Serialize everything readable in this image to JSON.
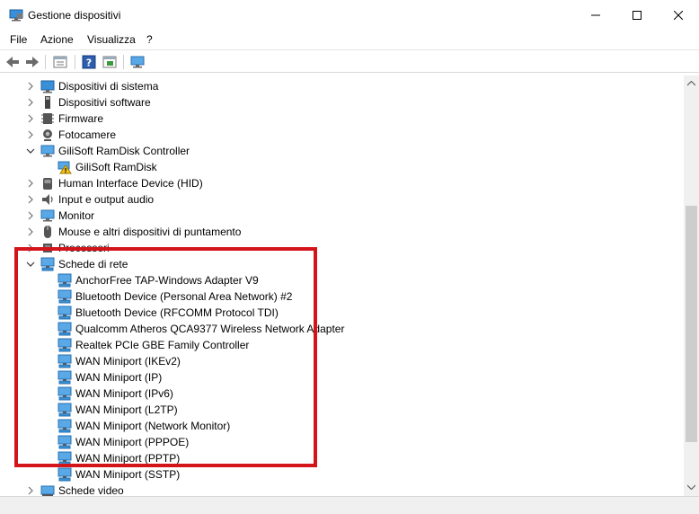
{
  "window": {
    "title": "Gestione dispositivi"
  },
  "menu": [
    "File",
    "Azione",
    "Visualizza",
    "?"
  ],
  "toolbar": {
    "buttons": [
      "back-icon",
      "forward-icon",
      "properties-icon",
      "help-icon",
      "driver-icon",
      "monitor-icon"
    ]
  },
  "tree": {
    "items": [
      {
        "label": "Dispositivi di sistema",
        "icon": "system-device-icon",
        "expanded": false,
        "level": 0
      },
      {
        "label": "Dispositivi software",
        "icon": "software-device-icon",
        "expanded": false,
        "level": 0
      },
      {
        "label": "Firmware",
        "icon": "firmware-icon",
        "expanded": false,
        "level": 0
      },
      {
        "label": "Fotocamere",
        "icon": "camera-icon",
        "expanded": false,
        "level": 0
      },
      {
        "label": "GiliSoft RamDisk Controller",
        "icon": "monitor-icon",
        "expanded": true,
        "level": 0
      },
      {
        "label": "GiliSoft RamDisk",
        "icon": "warning-device-icon",
        "level": 1
      },
      {
        "label": "Human Interface Device (HID)",
        "icon": "hid-icon",
        "expanded": false,
        "level": 0
      },
      {
        "label": "Input e output audio",
        "icon": "speaker-icon",
        "expanded": false,
        "level": 0
      },
      {
        "label": "Monitor",
        "icon": "monitor-icon",
        "expanded": false,
        "level": 0
      },
      {
        "label": "Mouse e altri dispositivi di puntamento",
        "icon": "mouse-icon",
        "expanded": false,
        "level": 0
      },
      {
        "label": "Processori",
        "icon": "processor-icon",
        "expanded": false,
        "level": 0
      },
      {
        "label": "Schede di rete",
        "icon": "network-adapter-icon",
        "expanded": true,
        "level": 0
      },
      {
        "label": "AnchorFree TAP-Windows Adapter V9",
        "icon": "network-adapter-icon",
        "level": 1
      },
      {
        "label": "Bluetooth Device (Personal Area Network) #2",
        "icon": "network-adapter-icon",
        "level": 1
      },
      {
        "label": "Bluetooth Device (RFCOMM Protocol TDI)",
        "icon": "network-adapter-icon",
        "level": 1
      },
      {
        "label": "Qualcomm Atheros QCA9377 Wireless Network Adapter",
        "icon": "network-adapter-icon",
        "level": 1
      },
      {
        "label": "Realtek PCIe GBE Family Controller",
        "icon": "network-adapter-icon",
        "level": 1
      },
      {
        "label": "WAN Miniport (IKEv2)",
        "icon": "network-adapter-icon",
        "level": 1
      },
      {
        "label": "WAN Miniport (IP)",
        "icon": "network-adapter-icon",
        "level": 1
      },
      {
        "label": "WAN Miniport (IPv6)",
        "icon": "network-adapter-icon",
        "level": 1
      },
      {
        "label": "WAN Miniport (L2TP)",
        "icon": "network-adapter-icon",
        "level": 1
      },
      {
        "label": "WAN Miniport (Network Monitor)",
        "icon": "network-adapter-icon",
        "level": 1
      },
      {
        "label": "WAN Miniport (PPPOE)",
        "icon": "network-adapter-icon",
        "level": 1
      },
      {
        "label": "WAN Miniport (PPTP)",
        "icon": "network-adapter-icon",
        "level": 1
      },
      {
        "label": "WAN Miniport (SSTP)",
        "icon": "network-adapter-icon",
        "level": 1
      },
      {
        "label": "Schede video",
        "icon": "display-adapter-icon",
        "expanded": false,
        "level": 0
      }
    ]
  },
  "colors": {
    "highlight": "#d4141b",
    "accent": "#1e7fd0"
  }
}
